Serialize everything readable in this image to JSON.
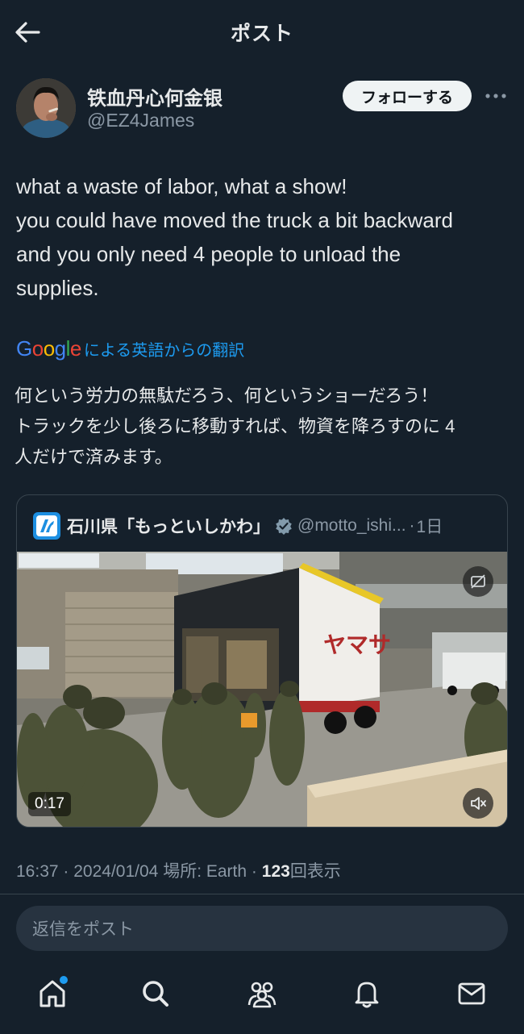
{
  "header": {
    "title": "ポスト",
    "back_icon": "arrow-left-icon"
  },
  "author": {
    "display_name": "铁血丹心何金银",
    "handle": "@EZ4James",
    "follow_label": "フォローする",
    "more_icon": "ellipsis-icon"
  },
  "post": {
    "lines": [
      "what a waste of labor, what a show!",
      "you could have moved the truck a bit backward",
      "and you only need 4 people to unload the",
      "supplies."
    ],
    "translation_source": "Google",
    "translation_label": "による英語からの翻訳",
    "translated_lines": [
      "何という労力の無駄だろう、何というショーだろう！",
      "トラックを少し後ろに移動すれば、物資を降ろすのに 4",
      "人だけで済みます。"
    ]
  },
  "quote": {
    "name": "石川県「もっといしかわ」",
    "handle": "@motto_ishi...",
    "separator": "·",
    "time": "1日",
    "truck_sign": "ヤマサ",
    "video_duration": "0:17"
  },
  "meta": {
    "time": "16:37",
    "date": "2024/01/04",
    "location_label": "場所: Earth",
    "views_count": "123",
    "views_label": "回表示",
    "sep": "·"
  },
  "reply": {
    "placeholder": "返信をポスト"
  },
  "nav": {
    "items": [
      "home-icon",
      "search-icon",
      "communities-icon",
      "notifications-icon",
      "messages-icon"
    ]
  },
  "colors": {
    "background": "#15202b",
    "accent": "#1d9bf0",
    "text": "#e7e9ea",
    "muted": "#8b98a5",
    "border": "#38444d"
  }
}
